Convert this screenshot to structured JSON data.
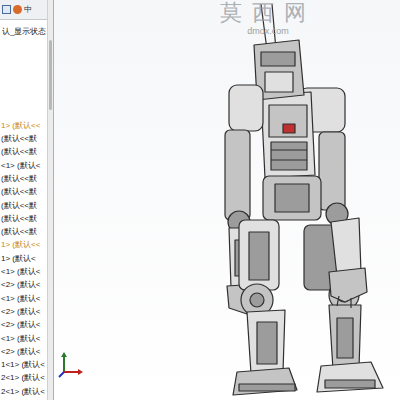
{
  "toolbar": {
    "tabs": [
      "中"
    ]
  },
  "feature_tree": {
    "header": "认_显示状态",
    "items": [
      {
        "label": "1> (默认<<",
        "color": "#c8860a"
      },
      {
        "label": "(默认<<默",
        "color": "#222222"
      },
      {
        "label": "(默认<<默",
        "color": "#222222"
      },
      {
        "label": "<1> (默认<",
        "color": "#222222"
      },
      {
        "label": "(默认<<默",
        "color": "#222222"
      },
      {
        "label": "(默认<<默",
        "color": "#222222"
      },
      {
        "label": "(默认<<默",
        "color": "#222222"
      },
      {
        "label": "(默认<<默",
        "color": "#222222"
      },
      {
        "label": "(默认<<默",
        "color": "#222222"
      },
      {
        "label": "1> (默认<<",
        "color": "#c8860a"
      },
      {
        "label": "1> (默认<",
        "color": "#222222"
      },
      {
        "label": "<1> (默认<",
        "color": "#222222"
      },
      {
        "label": "<2> (默认<",
        "color": "#222222"
      },
      {
        "label": "<1> (默认<",
        "color": "#222222"
      },
      {
        "label": "<2> (默认<",
        "color": "#222222"
      },
      {
        "label": "<2> (默认<",
        "color": "#222222"
      },
      {
        "label": "<1> (默认<",
        "color": "#222222"
      },
      {
        "label": "<2> (默认<",
        "color": "#222222"
      },
      {
        "label": "1<1> (默认<",
        "color": "#222222"
      },
      {
        "label": "2<1> (默认<",
        "color": "#222222"
      },
      {
        "label": "2<1> (默认<",
        "color": "#222222"
      }
    ]
  },
  "watermark": {
    "title": "莫西网",
    "url": "dmox.com"
  }
}
